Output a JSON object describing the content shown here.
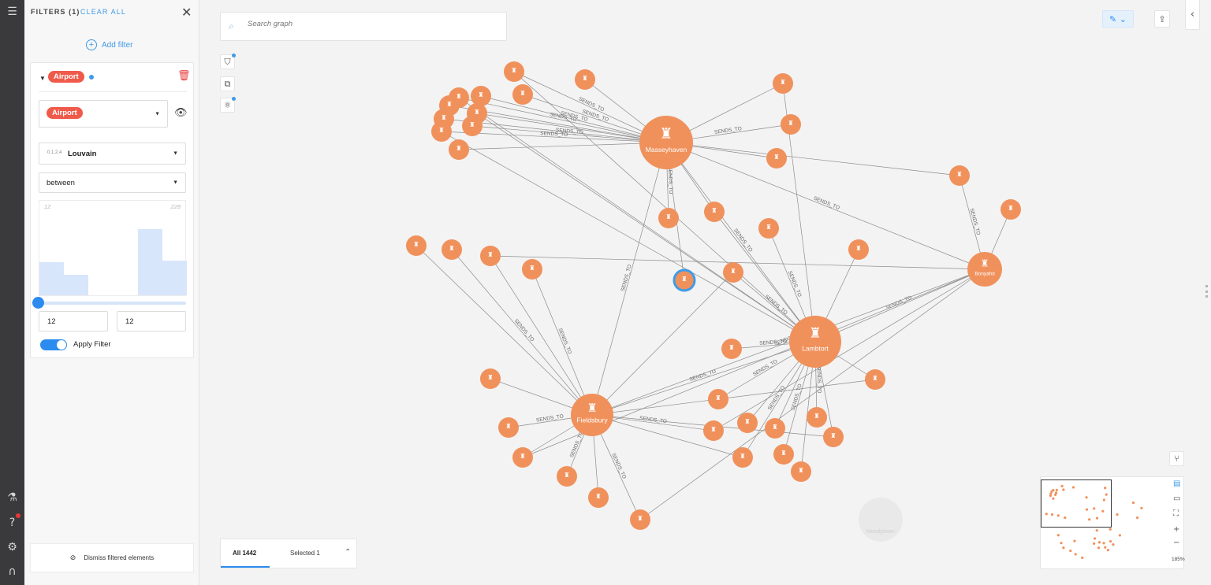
{
  "rail": {
    "icons": [
      "filter-panel-icon",
      "flask-icon",
      "help-icon",
      "settings-icon",
      "logo-icon"
    ]
  },
  "filters": {
    "header": "FILTERS (1)",
    "clear_all": "CLEAR ALL",
    "add_filter": "Add filter",
    "card": {
      "category_pill": "Airport",
      "selected_category": "Airport",
      "property_type": "0.1.2.4",
      "property": "Louvain",
      "operator": "between",
      "hist_min": "12",
      "hist_max": "228",
      "histogram": [
        0.4,
        0.25,
        0,
        0,
        0.8,
        0.42
      ],
      "range_from": "12",
      "range_to": "12",
      "apply_label": "Apply Filter",
      "apply_on": true
    },
    "dismiss": "Dismiss filtered elements"
  },
  "search": {
    "placeholder": "Search graph"
  },
  "tabs": {
    "all": "All 1442",
    "selected": "Selected 1"
  },
  "minimap": {
    "zoom": "185%"
  },
  "graph": {
    "edge_label": "SENDS_TO",
    "node_color": "#f0915c",
    "hubs": [
      "Masseyhaven",
      "Lambtort",
      "Fieldsbury",
      "Bonyafol"
    ],
    "selected_node_color": "#3f9be8",
    "faded_hub": "Moodytown"
  }
}
